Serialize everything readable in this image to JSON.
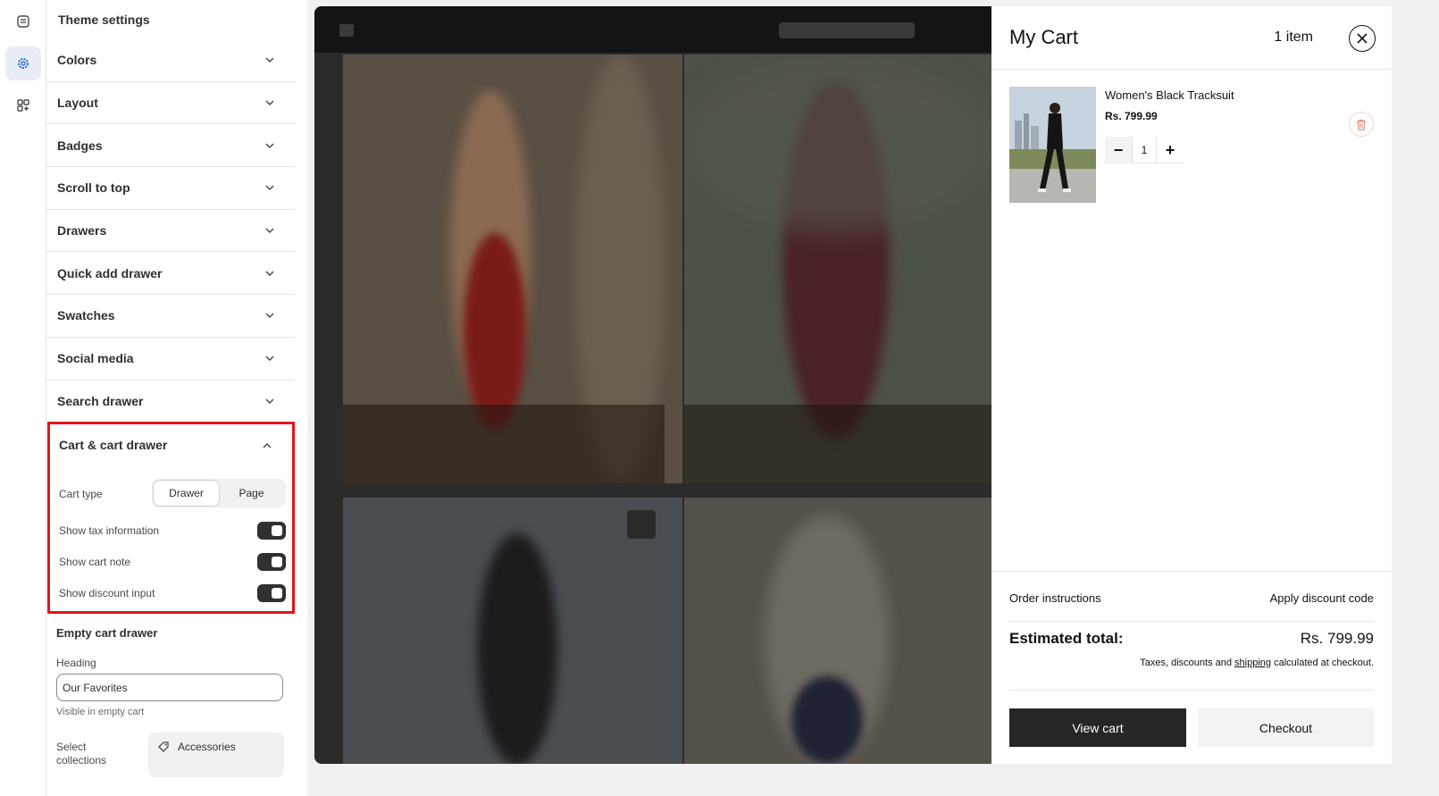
{
  "sidebar": {
    "title": "Theme settings",
    "sections": [
      {
        "label": "Colors"
      },
      {
        "label": "Layout"
      },
      {
        "label": "Badges"
      },
      {
        "label": "Scroll to top"
      },
      {
        "label": "Drawers"
      },
      {
        "label": "Quick add drawer"
      },
      {
        "label": "Swatches"
      },
      {
        "label": "Social media"
      },
      {
        "label": "Search drawer"
      }
    ],
    "cart": {
      "title": "Cart & cart drawer",
      "cart_type_label": "Cart type",
      "cart_type_options": [
        "Drawer",
        "Page"
      ],
      "cart_type_selected": "Drawer",
      "show_tax_label": "Show tax information",
      "show_tax": true,
      "show_note_label": "Show cart note",
      "show_note": true,
      "show_discount_label": "Show discount input",
      "show_discount": true
    },
    "empty_cart": {
      "title": "Empty cart drawer",
      "heading_label": "Heading",
      "heading_value": "Our Favorites",
      "hint": "Visible in empty cart",
      "collections_label": "Select collections",
      "collections": [
        "Accessories"
      ]
    }
  },
  "cart_drawer": {
    "title": "My Cart",
    "count": "1 item",
    "item": {
      "name": "Women's Black Tracksuit",
      "price": "Rs. 799.99",
      "quantity": "1"
    },
    "order_instructions": "Order instructions",
    "apply_discount": "Apply discount code",
    "estimated_label": "Estimated total:",
    "estimated_value": "Rs. 799.99",
    "tax_note_pre": "Taxes, discounts and",
    "tax_note_link": "shipping",
    "tax_note_post": "calculated at checkout.",
    "view_cart": "View cart",
    "checkout": "Checkout"
  },
  "colors": {
    "accent_highlight": "#e0141e",
    "toggle_on": "#303030",
    "primary_button": "#262626"
  }
}
